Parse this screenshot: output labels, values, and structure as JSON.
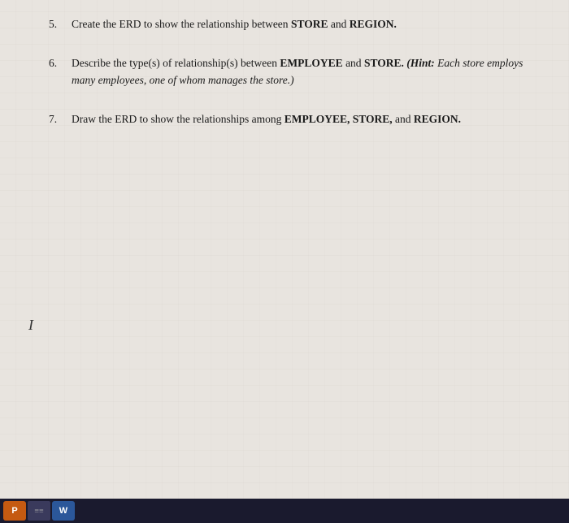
{
  "document": {
    "questions": [
      {
        "number": "5.",
        "text": "Create the ERD to show the relationship between STORE and REGION."
      },
      {
        "number": "6.",
        "text": "Describe the type(s) of relationship(s) between EMPLOYEE and STORE. (Hint: Each store employs many employees, one of whom manages the store.)"
      },
      {
        "number": "7.",
        "text": "Draw the ERD to show the relationships among EMPLOYEE, STORE, and REGION."
      }
    ]
  },
  "taskbar": {
    "powerpoint_label": "P",
    "files_label": "≡≡",
    "word_label": "W"
  },
  "cursor_symbol": "I"
}
